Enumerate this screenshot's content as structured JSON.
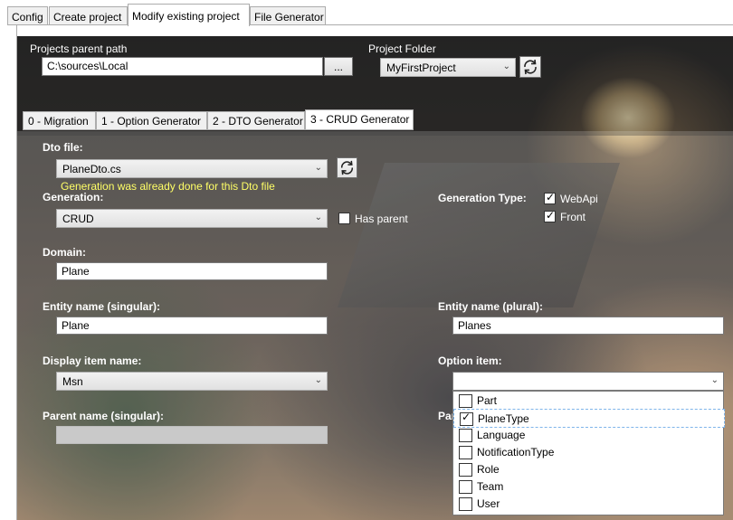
{
  "tabs": [
    {
      "label": "Config"
    },
    {
      "label": "Create project"
    },
    {
      "label": "Modify existing project"
    },
    {
      "label": "File Generator"
    }
  ],
  "projects_parent_path": {
    "label": "Projects parent path",
    "value": "C:\\sources\\Local",
    "browse_label": "..."
  },
  "project_folder": {
    "label": "Project Folder",
    "value": "MyFirstProject",
    "refresh_icon": "refresh-icon"
  },
  "inner_tabs": [
    {
      "label": "0 - Migration"
    },
    {
      "label": "1 - Option Generator"
    },
    {
      "label": "2 - DTO Generator"
    },
    {
      "label": "3 - CRUD Generator"
    }
  ],
  "dto_file": {
    "label": "Dto file:",
    "value": "PlaneDto.cs",
    "warning": "Generation was already done for this Dto file"
  },
  "generation": {
    "label": "Generation:",
    "value": "CRUD",
    "has_parent_label": "Has parent",
    "has_parent_checked": false
  },
  "generation_type": {
    "label": "Generation Type:",
    "webapi_label": "WebApi",
    "webapi_checked": true,
    "front_label": "Front",
    "front_checked": true
  },
  "domain": {
    "label": "Domain:",
    "value": "Plane"
  },
  "entity_singular": {
    "label": "Entity name (singular):",
    "value": "Plane"
  },
  "entity_plural": {
    "label": "Entity name (plural):",
    "value": "Planes"
  },
  "display_item": {
    "label": "Display item name:",
    "value": "Msn"
  },
  "option_item": {
    "label": "Option item:",
    "value": "",
    "options": [
      {
        "label": "Part",
        "checked": false
      },
      {
        "label": "PlaneType",
        "checked": true
      },
      {
        "label": "Language",
        "checked": false
      },
      {
        "label": "NotificationType",
        "checked": false
      },
      {
        "label": "Role",
        "checked": false
      },
      {
        "label": "Team",
        "checked": false
      },
      {
        "label": "User",
        "checked": false
      }
    ]
  },
  "parent_singular": {
    "label": "Parent name (singular):",
    "value": ""
  },
  "parent_plural": {
    "label": "Par"
  },
  "colors": {
    "warning": "#ffff66",
    "selection_border": "#7eb4ea",
    "lamp_glow": "#ffeebe"
  }
}
